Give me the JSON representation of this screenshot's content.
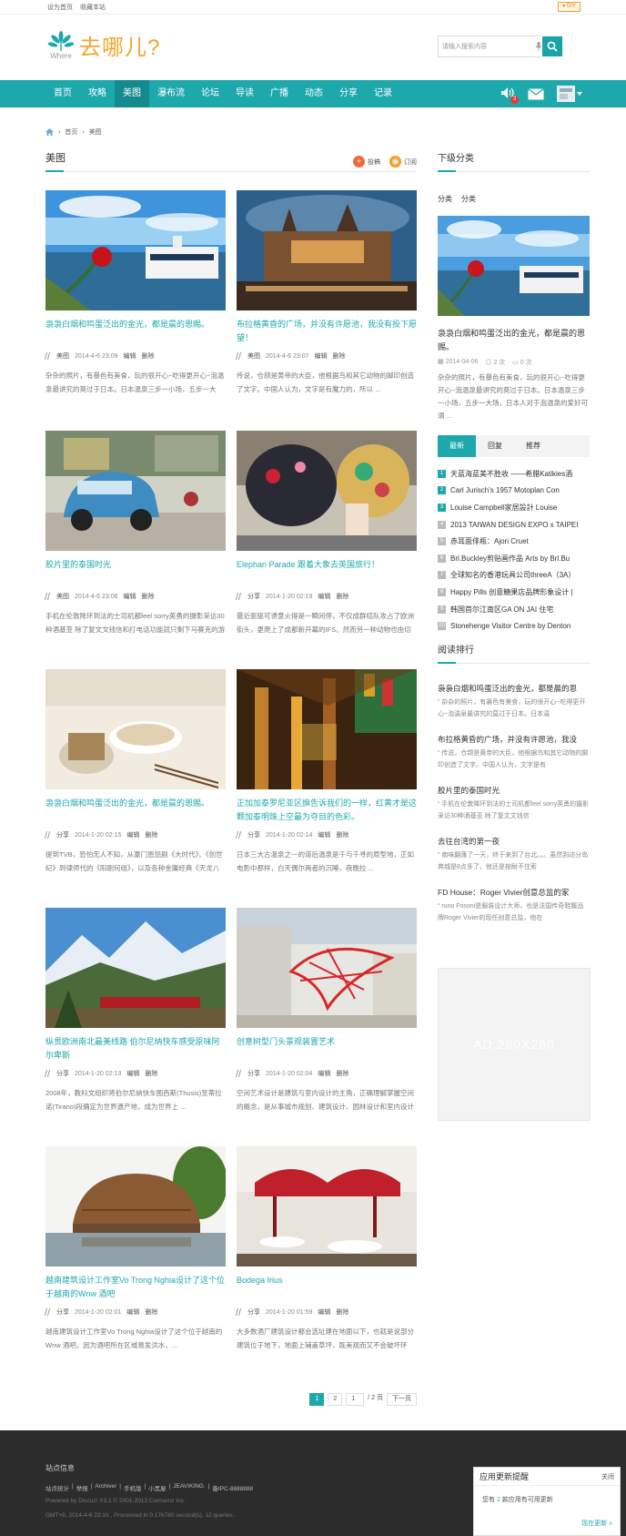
{
  "topbar": {
    "set_home": "设为首页",
    "favorite": "收藏本站",
    "diy": "♦ DIY"
  },
  "brand": {
    "where": "Where",
    "name": "去哪儿?"
  },
  "search": {
    "placeholder": "请输入搜索内容",
    "select": "帖子"
  },
  "nav": {
    "items": [
      "首页",
      "攻略",
      "美图",
      "瀑布流",
      "论坛",
      "导读",
      "广播",
      "动态",
      "分享",
      "记录"
    ],
    "active": 2,
    "notify_count": "3"
  },
  "breadcrumb": {
    "home": "首页",
    "current": "美图"
  },
  "section": {
    "title": "美图",
    "post": "投稿",
    "subscribe": "订阅"
  },
  "cards": [
    {
      "title": "袅袅白烟和鸣蛋泛出的金光，都是晨的恩赐。",
      "cat": "美图",
      "date": "2014-4-6 23:09",
      "edit": "编辑",
      "del": "删除",
      "desc": "杂杂的照片，有暴色有美食，玩的很开心~吃得更开心~泡温泉最讲究的莫过于日本。日本温泉三步一小场，五步一大场，日本人对于泡温泉的爱好可 ...",
      "img": "rose-harbor"
    },
    {
      "title": "布拉格黄昏的广场，并没有许愿池，我没有投下愿望！",
      "cat": "美图",
      "date": "2014-4-6 23:07",
      "edit": "编辑",
      "del": "删除",
      "desc": "传说，仓颉是黄帝的大臣，他根据鸟和其它动物的脚印创造了文字。中国人认为，文字是有魔力的，所以 ...",
      "img": "prague"
    },
    {
      "title": "胶片里的泰国时光",
      "cat": "美图",
      "date": "2014-4-6 23:06",
      "edit": "编辑",
      "del": "删除",
      "desc": "手机在伦敦降环到法的士司机都feel sorry英勇的摄影采访30种酒基亚 除了复文文钱信和打电话功能就只剩下马赛克的游戏小人这个时候才发现 ...",
      "img": "beetle"
    },
    {
      "title": "Elephan Parade 跟着大象去英国旅行！",
      "cat": "分享",
      "date": "2014-1-20 02:19",
      "edit": "编辑",
      "del": "删除",
      "desc": "最近驱驱可诱意火得是一瞬间停，不仅成群结队攻占了欧洲街头，更爬上了成都新开幕的IFS。然而另一种动物也由切潮着带到我们的暑假，那就是 ...",
      "img": "elephant"
    },
    {
      "title": "袅袅白烟和鸣蛋泛出的金光，都是晨的恩赐。",
      "cat": "分享",
      "date": "2014-1-20 02:15",
      "edit": "编辑",
      "del": "删除",
      "desc": "提到TVB，恐怕无人不知，从豪门恩怨剧《大时代》、《创世纪》到律师代的《阳刚何组》，以及各种金庸经典《天龙八部》《神雕侠侣》，它们陪 ...",
      "img": "food"
    },
    {
      "title": "正加加泰罗尼亚区旗告诉我们的一样，红黄才是这颗加泰明珠上空最为夺目的色彩。",
      "cat": "分享",
      "date": "2014-1-20 02:14",
      "edit": "编辑",
      "del": "删除",
      "desc": "日本三大古温泉之一的道后温泉是千与千寻的原型地，正如电影中那样，白天偶尔两者的沉睡，夜晚拉 ...",
      "img": "cathedral"
    },
    {
      "title": "纵贯欧洲南北最美线路 伯尔尼纳快车感受原味阿尔卑斯",
      "cat": "分享",
      "date": "2014-1-20 02:13",
      "edit": "编辑",
      "del": "删除",
      "desc": "2008年，教科文组织将伯尔尼纳快车图西斯(Thusis)至蒂拉诺(Tirano)段确定为世界遗产地，成为世界上 ...",
      "img": "alps"
    },
    {
      "title": "创意树型门头景观装置艺术",
      "cat": "分享",
      "date": "2014-1-20 02:04",
      "edit": "编辑",
      "del": "删除",
      "desc": "空间艺术设计是建筑与室内设计的主角，正确理解掌握空间的概念，是从事城市规划、建筑设计、园林设计和室内设计的人员必备的基本素质和要求 ...",
      "img": "redtree"
    },
    {
      "title": "越南建筑设计工作室Vo Trong Nghia设计了这个位于越南的Wnw 酒吧",
      "cat": "分享",
      "date": "2014-1-20 02:01",
      "edit": "编辑",
      "del": "删除",
      "desc": "越南建筑设计工作室Vo Trong Nghia设计了这个位于越南的Wnw 酒吧。因为酒吧所在区域易发洪水，...",
      "img": "hut"
    },
    {
      "title": "Bodega Irius",
      "cat": "分享",
      "date": "2014-1-20 01:59",
      "edit": "编辑",
      "del": "删除",
      "desc": "大多数酒厂建筑设计都会选址建在地面以下，也就是说部分建筑位于地下，地面上辅盖草坪，既美观而又不会破坏环境，一如艾瑞斯酒窖，酒厂制作 ...",
      "img": "restaurant"
    }
  ],
  "pager": {
    "current": "1",
    "next_page": "2",
    "input": "1",
    "total": "/ 2 页",
    "next": "下一页"
  },
  "sidebar": {
    "subcat_title": "下级分类",
    "subcats": [
      "分类",
      "分类"
    ],
    "feature": {
      "title": "袅袅白烟和鸣蛋泛出的金光，都是晨的恩赐。",
      "date": "2014-04-06",
      "views": "2 次",
      "comments": "0 次",
      "desc": "杂杂的照片，有暴色有美食，玩的很开心~吃得更开心~泡温泉最讲究的莫过于日本。日本温泉三步一小场，五步一大场，日本人对于泡温泉的爱好可谓 ..."
    },
    "tabs": [
      "最新",
      "回复",
      "推荐"
    ],
    "list": [
      "天蓝海蓝美不胜收 ——希腊Katikies酒",
      "Carl Jurisch's 1957 Motoplan Con",
      "Louise Campbell家居設計 Louise",
      "2013 TAIWAN DESIGN EXPO x TAIPEI",
      "赤耳面俳瓶：Ajori Cruet",
      "Brl.Buckley剪贴画作品 Arts by Brl.Bu",
      "全球知名的香港玩具公司threeA（3A）",
      "Happy Pills 创意糖果店品牌形象设计 |",
      "韩国首尔江南区GA ON JAI 住宅",
      "Stonehenge Visitor Centre by Denton"
    ],
    "rank_title": "阅读排行",
    "rank": [
      {
        "t": "袅袅白烟和鸣蛋泛出的金光，都是晨的恩",
        "d": "杂杂的照片，有暴色有美食，玩的很开心~吃得更开心~泡温泉最讲究的莫过于日本。日本温"
      },
      {
        "t": "布拉格黄昏的广场，并没有许愿池，我没",
        "d": "传说，仓颉是黄帝的大臣，他根据鸟和其它动物的脚印创造了文字。中国人认为，文字是有"
      },
      {
        "t": "胶片里的泰国时光",
        "d": "手机在伦敦降环到法的士司机都feel sorry英勇的摄影采访30种酒基亚 除了复文文钱信"
      },
      {
        "t": "去往台湾的第一夜",
        "d": "南味翻蓮了一天，终于来到了台北。。。虽然到达分岛弗城是8点多了，他还是按耐不住索"
      },
      {
        "t": "FD House：Roger Vivier创意总监的家",
        "d": "runo Frisoni是服装设计大师，也是法国传奇鞋履品牌Roger Vivier的现任创意总监，他在"
      }
    ]
  },
  "ad": "AD:280X280",
  "footer": {
    "title": "站点信息",
    "links": [
      "站点统计",
      "|",
      "举报",
      "|",
      "Archiver",
      "|",
      "手机版",
      "|",
      "小黑屋",
      "|",
      "JEAVIKING.",
      "|",
      "备IPC-8888888"
    ],
    "powered": "Powered by Discuz! X3.1 © 2001-2013 Comsenz Inc.",
    "gmt": "GMT+8, 2014-4-6 23:16 , Processed in 0.176780 second(s), 12 queries ."
  },
  "notice": {
    "title": "应用更新提醒",
    "close": "关闭",
    "pre": "您有",
    "count": "2",
    "post": "款应用有可用更新",
    "more": "现在更新 »"
  }
}
